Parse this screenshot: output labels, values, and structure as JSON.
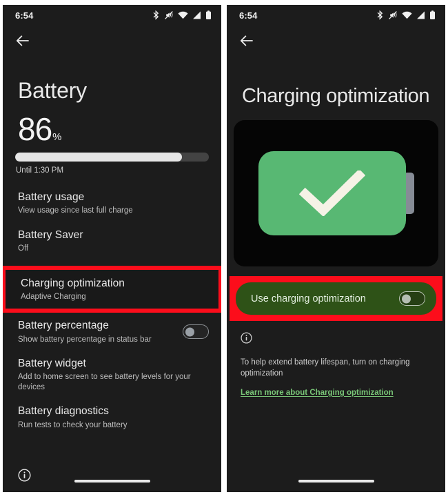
{
  "colors": {
    "screen_bg": "#1c1c1c",
    "highlight_red": "#fc0d1b",
    "battery_green": "#58b873",
    "row_green": "#2e5217",
    "link_green": "#79c577",
    "text_primary": "#e9e9e9",
    "text_secondary": "#bdbdbd"
  },
  "left_panel": {
    "status_bar": {
      "time": "6:54",
      "icons": [
        "bluetooth-icon",
        "vibrate-mute-icon",
        "wifi-icon",
        "cellular-signal-icon",
        "battery-icon"
      ]
    },
    "back_button": "back-arrow-icon",
    "title": "Battery",
    "battery_level": {
      "value": "86",
      "symbol": "%",
      "percent": 86,
      "estimate": "Until 1:30 PM"
    },
    "rows": [
      {
        "title": "Battery usage",
        "subtitle": "View usage since last full charge",
        "has_toggle": false,
        "highlighted": false
      },
      {
        "title": "Battery Saver",
        "subtitle": "Off",
        "has_toggle": false,
        "highlighted": false
      },
      {
        "title": "Charging optimization",
        "subtitle": "Adaptive Charging",
        "has_toggle": false,
        "highlighted": true
      },
      {
        "title": "Battery percentage",
        "subtitle": "Show battery percentage in status bar",
        "has_toggle": true,
        "toggle_state": "off",
        "highlighted": false
      },
      {
        "title": "Battery widget",
        "subtitle": "Add to home screen to see battery levels for your devices",
        "has_toggle": false,
        "highlighted": false
      },
      {
        "title": "Battery diagnostics",
        "subtitle": "Run tests to check your battery",
        "has_toggle": false,
        "highlighted": false
      }
    ],
    "bottom": {
      "info_icon": "info-circle-icon",
      "home_indicator": "home-indicator"
    }
  },
  "right_panel": {
    "status_bar": {
      "time": "6:54",
      "icons": [
        "bluetooth-icon",
        "vibrate-mute-icon",
        "wifi-icon",
        "cellular-signal-icon",
        "battery-icon"
      ]
    },
    "back_button": "back-arrow-icon",
    "title": "Charging optimization",
    "illustration": {
      "name": "battery-check-illustration",
      "battery_color": "#58b873",
      "check_mark": "checkmark-icon"
    },
    "toggle_row": {
      "label": "Use charging optimization",
      "toggle_state": "off",
      "highlighted": true
    },
    "info": {
      "icon": "info-circle-icon",
      "text": "To help extend battery lifespan, turn on charging optimization",
      "link": "Learn more about Charging optimization"
    },
    "bottom": {
      "home_indicator": "home-indicator"
    }
  }
}
